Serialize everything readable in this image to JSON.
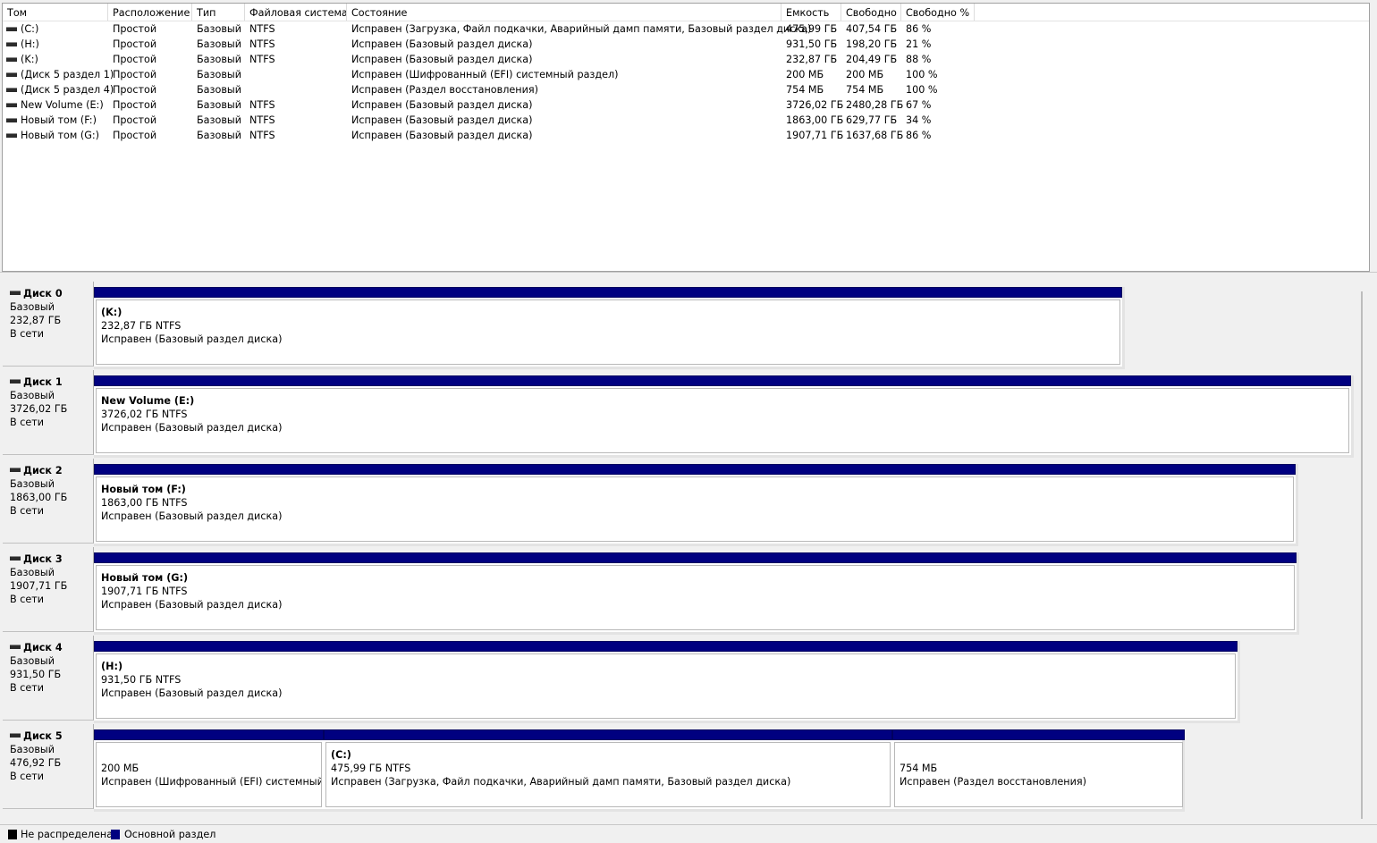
{
  "columns": [
    "Том",
    "Расположение",
    "Тип",
    "Файловая система",
    "Состояние",
    "Емкость",
    "Свободно",
    "Свободно %"
  ],
  "volumes": [
    {
      "name": "(C:)",
      "layout": "Простой",
      "type": "Базовый",
      "fs": "NTFS",
      "status": "Исправен (Загрузка, Файл подкачки, Аварийный дамп памяти, Базовый раздел диска)",
      "capacity": "475,99 ГБ",
      "free": "407,54 ГБ",
      "free_pct": "86 %"
    },
    {
      "name": "(H:)",
      "layout": "Простой",
      "type": "Базовый",
      "fs": "NTFS",
      "status": "Исправен (Базовый раздел диска)",
      "capacity": "931,50 ГБ",
      "free": "198,20 ГБ",
      "free_pct": "21 %"
    },
    {
      "name": "(K:)",
      "layout": "Простой",
      "type": "Базовый",
      "fs": "NTFS",
      "status": "Исправен (Базовый раздел диска)",
      "capacity": "232,87 ГБ",
      "free": "204,49 ГБ",
      "free_pct": "88 %"
    },
    {
      "name": "(Диск 5 раздел 1)",
      "layout": "Простой",
      "type": "Базовый",
      "fs": "",
      "status": "Исправен (Шифрованный (EFI) системный раздел)",
      "capacity": "200 МБ",
      "free": "200 МБ",
      "free_pct": "100 %"
    },
    {
      "name": "(Диск 5 раздел 4)",
      "layout": "Простой",
      "type": "Базовый",
      "fs": "",
      "status": "Исправен (Раздел восстановления)",
      "capacity": "754 МБ",
      "free": "754 МБ",
      "free_pct": "100 %"
    },
    {
      "name": "New Volume (E:)",
      "layout": "Простой",
      "type": "Базовый",
      "fs": "NTFS",
      "status": "Исправен (Базовый раздел диска)",
      "capacity": "3726,02 ГБ",
      "free": "2480,28 ГБ",
      "free_pct": "67 %"
    },
    {
      "name": "Новый том (F:)",
      "layout": "Простой",
      "type": "Базовый",
      "fs": "NTFS",
      "status": "Исправен (Базовый раздел диска)",
      "capacity": "1863,00 ГБ",
      "free": "629,77 ГБ",
      "free_pct": "34 %"
    },
    {
      "name": "Новый том (G:)",
      "layout": "Простой",
      "type": "Базовый",
      "fs": "NTFS",
      "status": "Исправен (Базовый раздел диска)",
      "capacity": "1907,71 ГБ",
      "free": "1637,68 ГБ",
      "free_pct": "86 %"
    }
  ],
  "disks": [
    {
      "name": "Диск 0",
      "type": "Базовый",
      "size": "232,87 ГБ",
      "state": "В сети",
      "partitions": [
        {
          "title": "(K:)",
          "size_fs": "232,87 ГБ NTFS",
          "status": "Исправен (Базовый раздел диска)"
        }
      ]
    },
    {
      "name": "Диск 1",
      "type": "Базовый",
      "size": "3726,02 ГБ",
      "state": "В сети",
      "partitions": [
        {
          "title": "New Volume  (E:)",
          "size_fs": "3726,02 ГБ NTFS",
          "status": "Исправен (Базовый раздел диска)"
        }
      ]
    },
    {
      "name": "Диск 2",
      "type": "Базовый",
      "size": "1863,00 ГБ",
      "state": "В сети",
      "partitions": [
        {
          "title": "Новый том  (F:)",
          "size_fs": "1863,00 ГБ NTFS",
          "status": "Исправен (Базовый раздел диска)"
        }
      ]
    },
    {
      "name": "Диск 3",
      "type": "Базовый",
      "size": "1907,71 ГБ",
      "state": "В сети",
      "partitions": [
        {
          "title": "Новый том  (G:)",
          "size_fs": "1907,71 ГБ NTFS",
          "status": "Исправен (Базовый раздел диска)"
        }
      ]
    },
    {
      "name": "Диск 4",
      "type": "Базовый",
      "size": "931,50 ГБ",
      "state": "В сети",
      "partitions": [
        {
          "title": "(H:)",
          "size_fs": "931,50 ГБ NTFS",
          "status": "Исправен (Базовый раздел диска)"
        }
      ]
    },
    {
      "name": "Диск 5",
      "type": "Базовый",
      "size": "476,92 ГБ",
      "state": "В сети",
      "partitions": [
        {
          "title": "",
          "size_fs": "200 МБ",
          "status": "Исправен (Шифрованный (EFI) системный раздел)"
        },
        {
          "title": "(C:)",
          "size_fs": "475,99 ГБ NTFS",
          "status": "Исправен (Загрузка, Файл подкачки, Аварийный дамп памяти, Базовый раздел диска)"
        },
        {
          "title": "",
          "size_fs": "754 МБ",
          "status": "Исправен (Раздел восстановления)"
        }
      ]
    }
  ],
  "legend": [
    {
      "label": "Не распределена",
      "color": "#000000"
    },
    {
      "label": "Основной раздел",
      "color": "#000080"
    }
  ]
}
